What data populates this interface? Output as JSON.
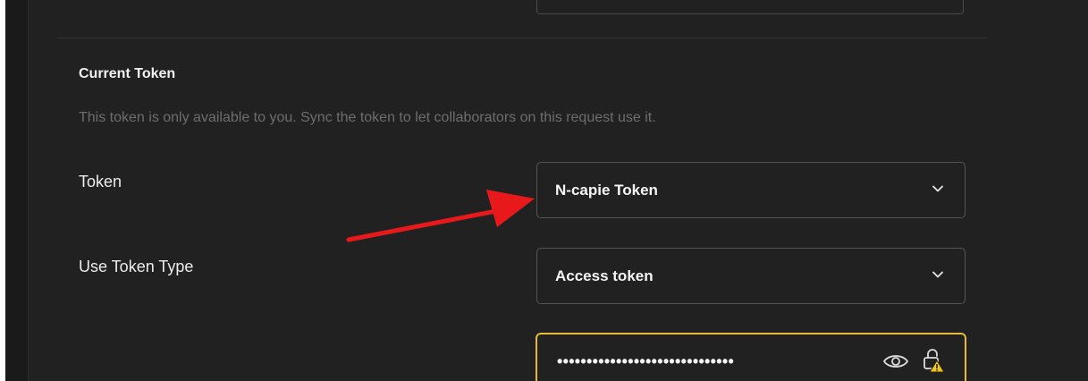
{
  "section": {
    "title": "Current Token",
    "description": "This token is only available to you. Sync the token to let collaborators on this request use it."
  },
  "token": {
    "label": "Token",
    "selected": "N-capie Token"
  },
  "token_type": {
    "label": "Use Token Type",
    "selected": "Access token"
  },
  "token_value": {
    "masked": "••••••••••••••••••••••••••••••"
  },
  "icons": {
    "chevron": "chevron-down-icon",
    "eye": "eye-icon",
    "lock": "lock-warning-icon",
    "annotation": "red-arrow-annotation"
  },
  "colors": {
    "background": "#212121",
    "focus_border": "#e9b938",
    "annotation_arrow": "#e8191b",
    "warning": "#f5c518"
  }
}
